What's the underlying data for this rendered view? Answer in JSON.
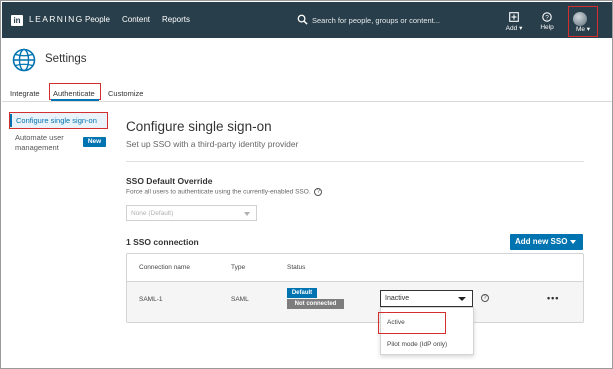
{
  "topbar": {
    "logo_text": "in",
    "brand": "LEARNING",
    "nav": [
      "People",
      "Content",
      "Reports"
    ],
    "search_placeholder": "Search for people, groups or content...",
    "add_label": "Add",
    "help_label": "Help",
    "me_label": "Me"
  },
  "header": {
    "title": "Settings"
  },
  "tabs": [
    {
      "label": "Integrate"
    },
    {
      "label": "Authenticate",
      "active": true
    },
    {
      "label": "Customize"
    }
  ],
  "sidebar": {
    "items": [
      {
        "label": "Configure single sign-on",
        "selected": true
      },
      {
        "label": "Automate user management",
        "badge": "New"
      }
    ]
  },
  "main": {
    "title": "Configure single sign-on",
    "subtitle": "Set up SSO with a third-party identity provider",
    "override": {
      "title": "SSO Default Override",
      "description": "Force all users to authenticate using the currently-enabled SSO.",
      "select_value": "None (Default)"
    },
    "connections_label": "1 SSO connection",
    "add_button": "Add new SSO",
    "table": {
      "headers": [
        "Connection name",
        "Type",
        "Status"
      ],
      "rows": [
        {
          "name": "SAML-1",
          "type": "SAML",
          "badges": [
            "Default",
            "Not connected"
          ],
          "status_value": "Inactive",
          "more": "•••"
        }
      ]
    },
    "dropdown_options": [
      "Active",
      "Pilot mode (IdP only)"
    ]
  },
  "colors": {
    "topbar": "#283e4a",
    "accent": "#0073b1",
    "highlight": "#d32f2f",
    "badge_gray": "#7d7d7d"
  }
}
